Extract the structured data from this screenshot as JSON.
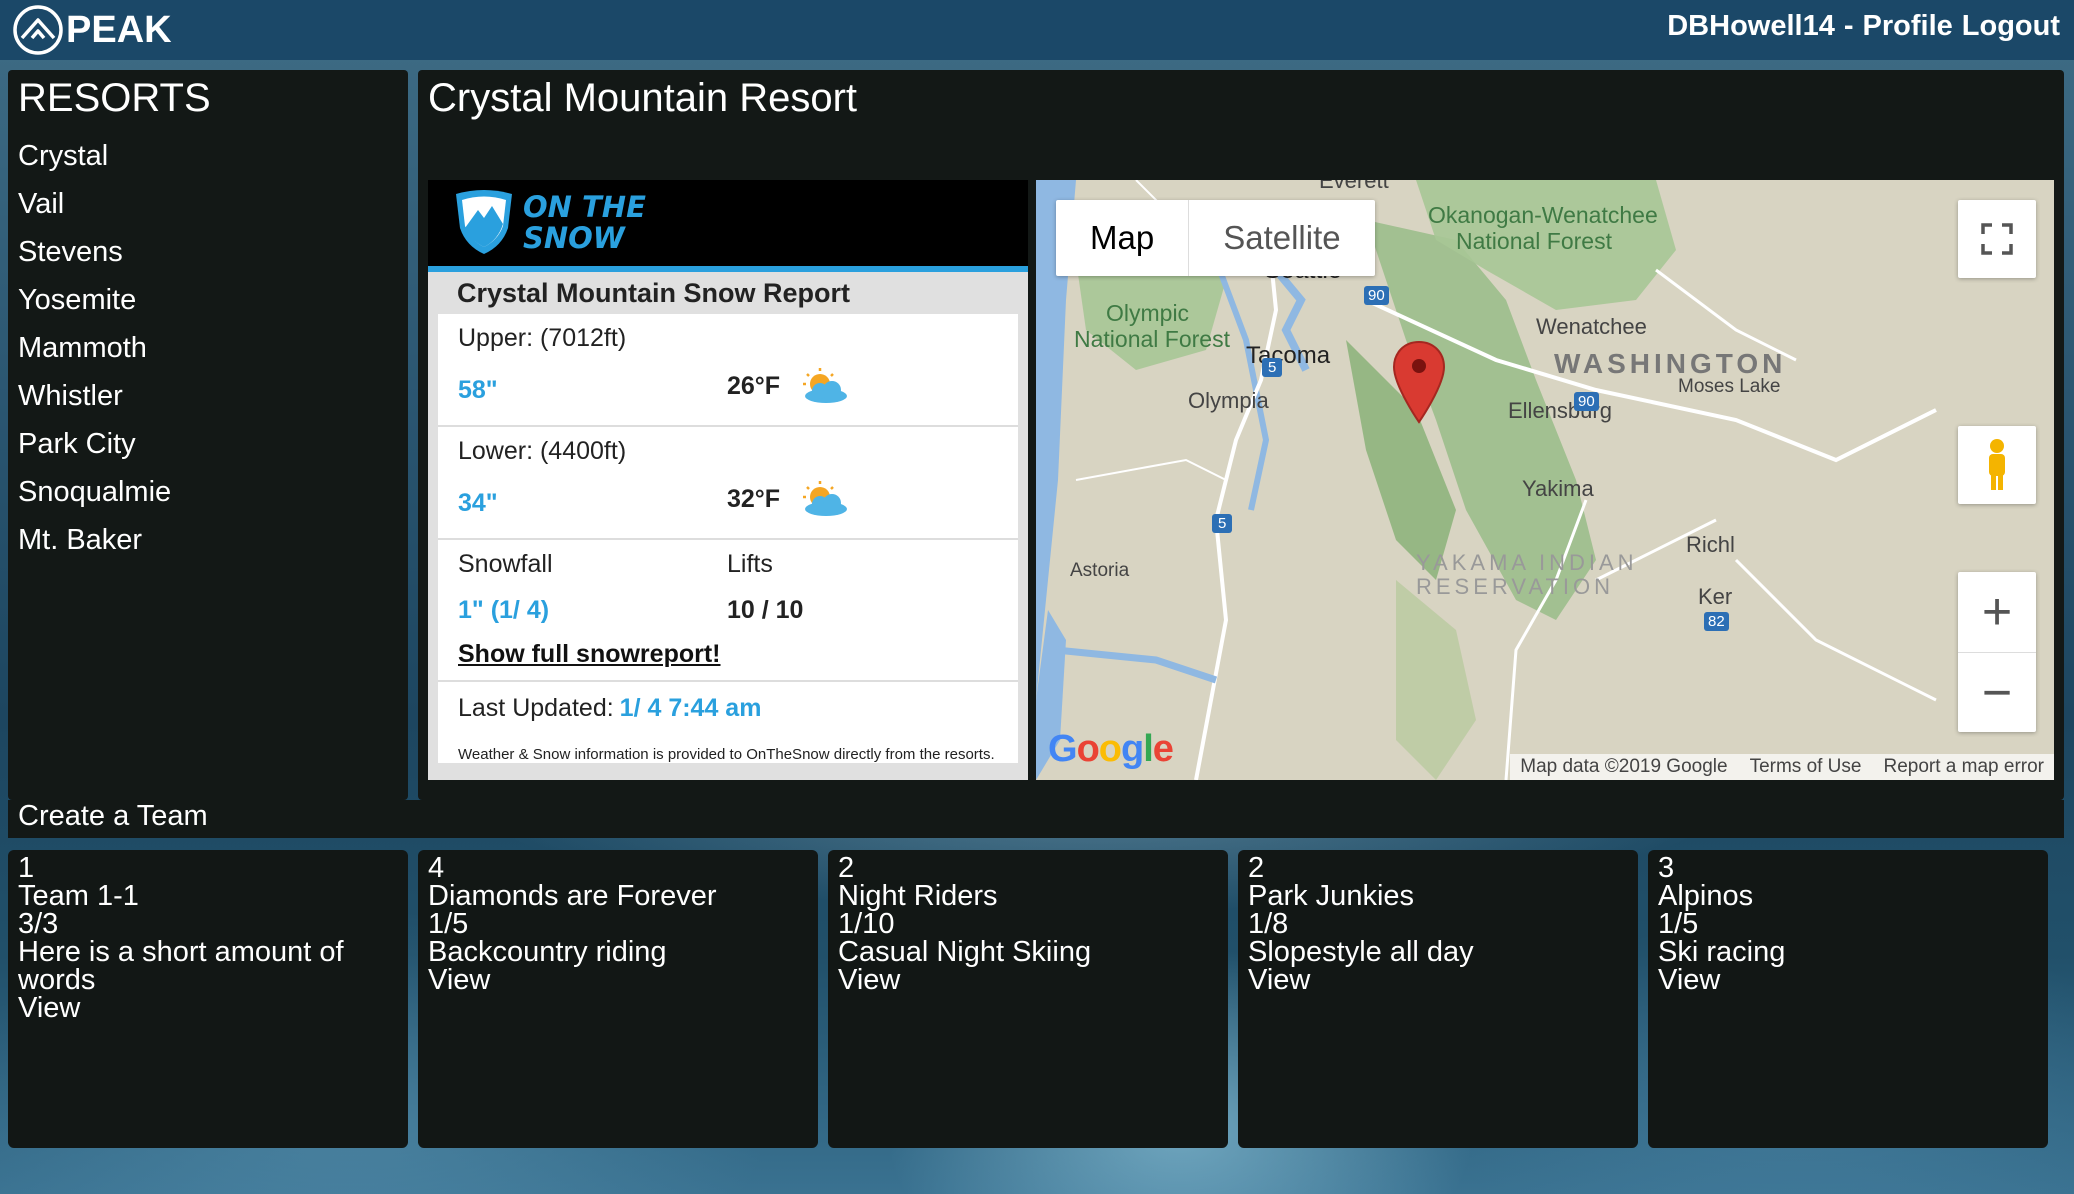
{
  "header": {
    "logo_text": "PEAK",
    "username": "DBHowell14",
    "separator": "-",
    "profile": "Profile",
    "logout": "Logout"
  },
  "sidebar": {
    "title": "RESORTS",
    "items": [
      "Crystal",
      "Vail",
      "Stevens",
      "Yosemite",
      "Mammoth",
      "Whistler",
      "Park City",
      "Snoqualmie",
      "Mt. Baker"
    ]
  },
  "main": {
    "resort_title": "Crystal Mountain Resort"
  },
  "widget": {
    "brand_line1": "ON THE",
    "brand_line2": "SNOW",
    "report_title": "Crystal Mountain Snow Report",
    "upper_label": "Upper: (7012ft)",
    "upper_depth": "58\"",
    "upper_temp": "26°F",
    "lower_label": "Lower: (4400ft)",
    "lower_depth": "34\"",
    "lower_temp": "32°F",
    "snowfall_label": "Snowfall",
    "lifts_label": "Lifts",
    "snowfall_value": "1\" (1/ 4)",
    "lifts_value": "10 / 10",
    "full_report_link": "Show full snowreport!",
    "updated_label": "Last Updated:",
    "updated_value": "1/ 4 7:44 am",
    "disclaimer": "Weather & Snow information is provided to OnTheSnow directly from the resorts."
  },
  "map": {
    "type_map": "Map",
    "type_satellite": "Satellite",
    "zoom_in": "+",
    "zoom_out": "−",
    "google": "Google",
    "footer_data": "Map data ©2019 Google",
    "footer_terms": "Terms of Use",
    "footer_report": "Report a map error",
    "labels": {
      "everett": "Everett",
      "okanogan": "Okanogan-Wenatchee",
      "national_forest": "National Forest",
      "seattle": "Seattle",
      "olympic": "Olympic",
      "olympic_nf": "National Forest",
      "wenatchee": "Wenatchee",
      "tacoma": "Tacoma",
      "washington": "WASHINGTON",
      "moses_lake": "Moses Lake",
      "olympia": "Olympia",
      "ellensburg": "Ellensburg",
      "yakima": "Yakima",
      "richland": "Richl",
      "astoria": "Astoria",
      "yakama": "YAKAMA INDIAN",
      "reservation": "RESERVATION",
      "kennewick": "Ker",
      "i90": "90",
      "i5": "5",
      "i82": "82"
    }
  },
  "create_team": "Create a Team",
  "teams": [
    {
      "count": "1",
      "name": "Team 1-1",
      "members": "3/3",
      "description": "Here is a short amount of words",
      "action": "View"
    },
    {
      "count": "4",
      "name": "Diamonds are Forever",
      "members": "1/5",
      "description": "Backcountry riding",
      "action": "View"
    },
    {
      "count": "2",
      "name": "Night Riders",
      "members": "1/10",
      "description": "Casual Night Skiing",
      "action": "View"
    },
    {
      "count": "2",
      "name": "Park Junkies",
      "members": "1/8",
      "description": "Slopestyle all day",
      "action": "View"
    },
    {
      "count": "3",
      "name": "Alpinos",
      "members": "1/5",
      "description": "Ski racing",
      "action": "View"
    }
  ],
  "colors": {
    "header_bg": "#1b4868",
    "panel_bg": "#131816",
    "accent_blue": "#2aa0de",
    "pin_red": "#d93a31"
  },
  "icons": [
    "peak-logo-icon",
    "onthesnow-shield-icon",
    "partly-cloudy-icon",
    "fullscreen-icon",
    "pegman-icon",
    "map-pin-icon"
  ]
}
